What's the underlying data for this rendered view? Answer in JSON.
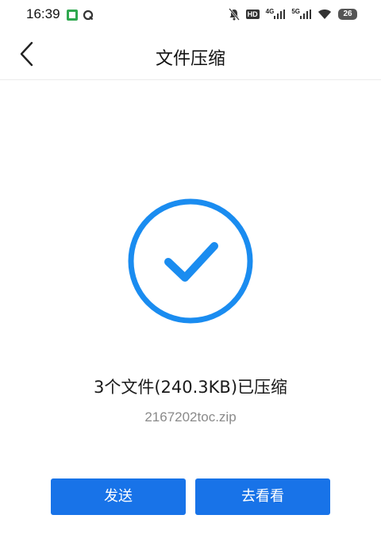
{
  "status_bar": {
    "time": "16:39",
    "icons": [
      "wechat-style-app-icon",
      "q-app-icon",
      "mute-icon",
      "hd-icon",
      "signal-4g-icon",
      "signal-5g-icon",
      "wifi-icon",
      "battery-icon"
    ],
    "hd_label": "HD",
    "net_4g": "4G",
    "net_5g": "5G",
    "battery": "26"
  },
  "header": {
    "back_icon": "chevron-left-icon",
    "title": "文件压缩"
  },
  "result": {
    "icon": "check-circle-icon",
    "message": "3个文件(240.3KB)已压缩",
    "file_name": "2167202toc.zip"
  },
  "actions": {
    "send_label": "发送",
    "view_label": "去看看"
  },
  "colors": {
    "accent": "#1873e8",
    "check": "#1a8cf0"
  }
}
